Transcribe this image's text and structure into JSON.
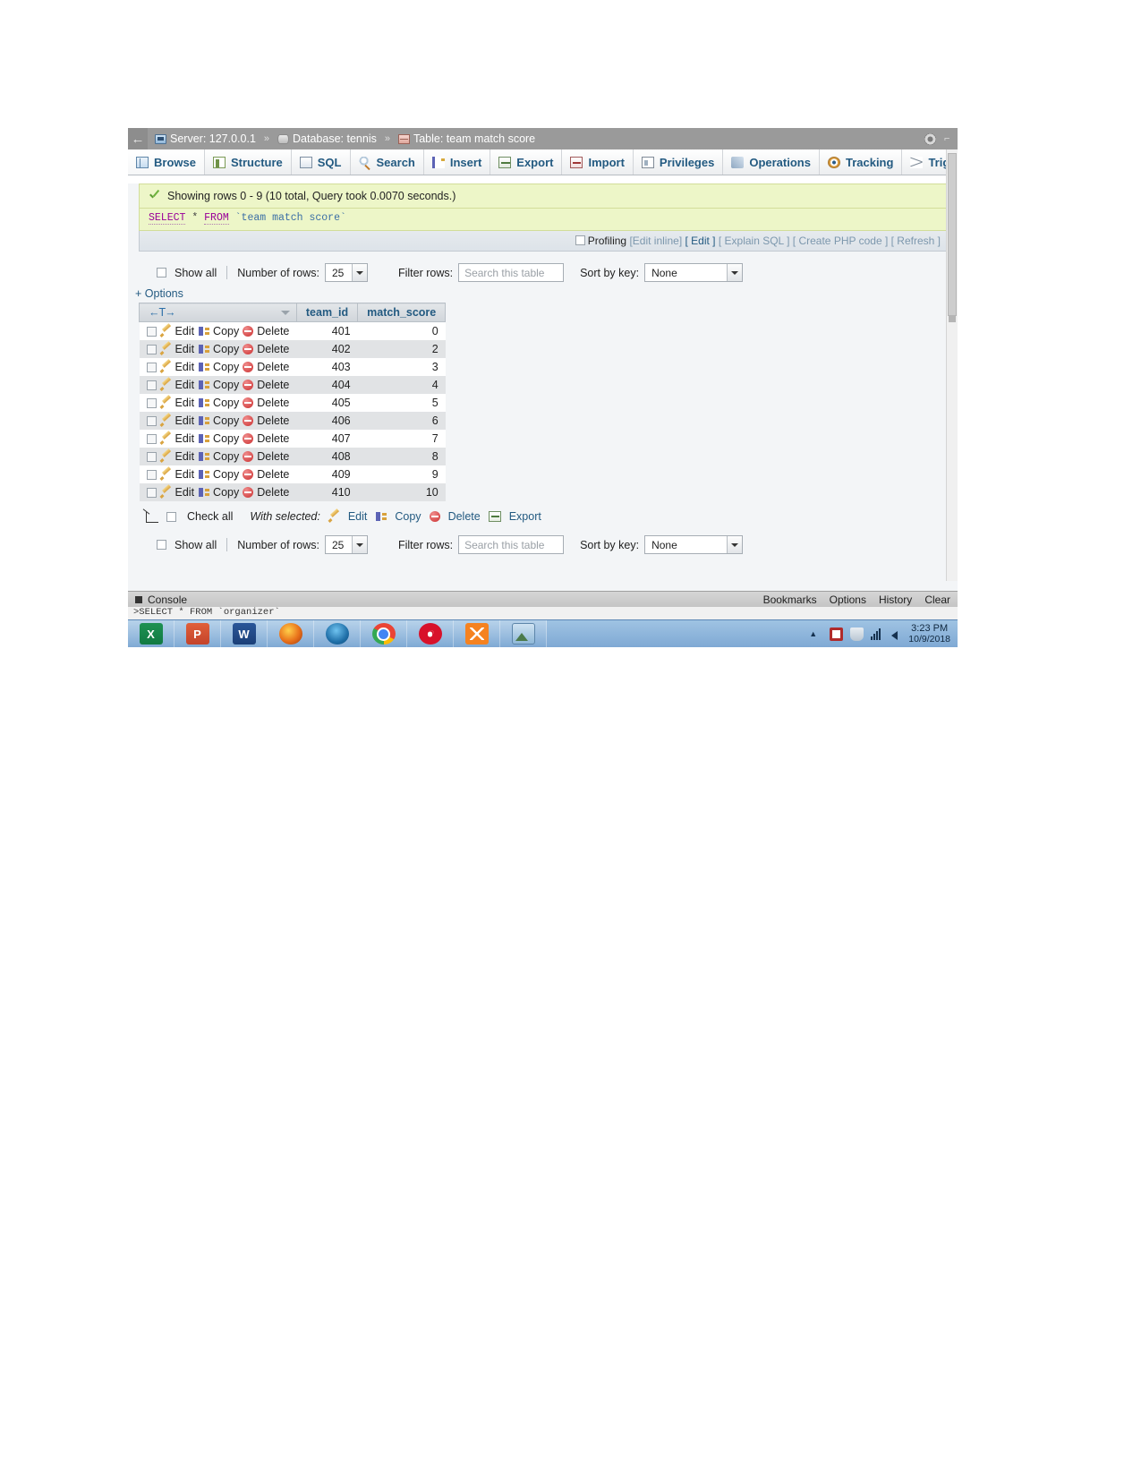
{
  "breadcrumb": {
    "server_icon": "server-icon",
    "server": "Server: 127.0.0.1",
    "sep1": "»",
    "database": "Database: tennis",
    "sep2": "»",
    "table": "Table: team match score"
  },
  "tabs": [
    {
      "label": "Browse",
      "icon": "browse-icon"
    },
    {
      "label": "Structure",
      "icon": "structure-icon"
    },
    {
      "label": "SQL",
      "icon": "sql-icon"
    },
    {
      "label": "Search",
      "icon": "search-icon"
    },
    {
      "label": "Insert",
      "icon": "insert-icon"
    },
    {
      "label": "Export",
      "icon": "export-icon"
    },
    {
      "label": "Import",
      "icon": "import-icon"
    },
    {
      "label": "Privileges",
      "icon": "privileges-icon"
    },
    {
      "label": "Operations",
      "icon": "operations-icon"
    },
    {
      "label": "Tracking",
      "icon": "tracking-icon"
    },
    {
      "label": "Triggers",
      "icon": "triggers-icon"
    }
  ],
  "result": {
    "message": "Showing rows 0 - 9 (10 total, Query took 0.0070 seconds.)",
    "sql_keyword1": "SELECT",
    "sql_star": "*",
    "sql_keyword2": "FROM",
    "sql_table": "`team match score`"
  },
  "profiling": {
    "label": "Profiling",
    "edit_inline": "[Edit inline]",
    "edit": "[ Edit ]",
    "explain": "[ Explain SQL ]",
    "create_php": "[ Create PHP code ]",
    "refresh": "[ Refresh ]"
  },
  "toolbar": {
    "show_all": "Show all",
    "number_of_rows_label": "Number of rows:",
    "number_of_rows_value": "25",
    "filter_rows_label": "Filter rows:",
    "filter_rows_placeholder": "Search this table",
    "sort_by_key_label": "Sort by key:",
    "sort_by_key_value": "None",
    "options_link": "+ Options"
  },
  "table": {
    "sort_header": "←T→",
    "columns": [
      "team_id",
      "match_score"
    ],
    "row_actions": {
      "edit": "Edit",
      "copy": "Copy",
      "delete": "Delete"
    },
    "rows": [
      {
        "team_id": "401",
        "match_score": "0"
      },
      {
        "team_id": "402",
        "match_score": "2"
      },
      {
        "team_id": "403",
        "match_score": "3"
      },
      {
        "team_id": "404",
        "match_score": "4"
      },
      {
        "team_id": "405",
        "match_score": "5"
      },
      {
        "team_id": "406",
        "match_score": "6"
      },
      {
        "team_id": "407",
        "match_score": "7"
      },
      {
        "team_id": "408",
        "match_score": "8"
      },
      {
        "team_id": "409",
        "match_score": "9"
      },
      {
        "team_id": "410",
        "match_score": "10"
      }
    ]
  },
  "footer": {
    "check_all": "Check all",
    "with_selected": "With selected:",
    "edit": "Edit",
    "copy": "Copy",
    "delete": "Delete",
    "export": "Export"
  },
  "console": {
    "label": "Console",
    "links": [
      "Bookmarks",
      "Options",
      "History",
      "Clear"
    ],
    "command": ">SELECT * FROM `organizer`"
  },
  "taskbar": {
    "apps": [
      {
        "name": "excel",
        "glyph": "X"
      },
      {
        "name": "powerpoint",
        "glyph": "P"
      },
      {
        "name": "word",
        "glyph": "W"
      },
      {
        "name": "firefox",
        "glyph": ""
      },
      {
        "name": "thunderbird",
        "glyph": ""
      },
      {
        "name": "chrome",
        "glyph": ""
      },
      {
        "name": "opera",
        "glyph": "O"
      },
      {
        "name": "xampp",
        "glyph": ""
      },
      {
        "name": "photo-viewer",
        "glyph": ""
      }
    ],
    "clock_time": "3:23 PM",
    "clock_date": "10/9/2018"
  }
}
